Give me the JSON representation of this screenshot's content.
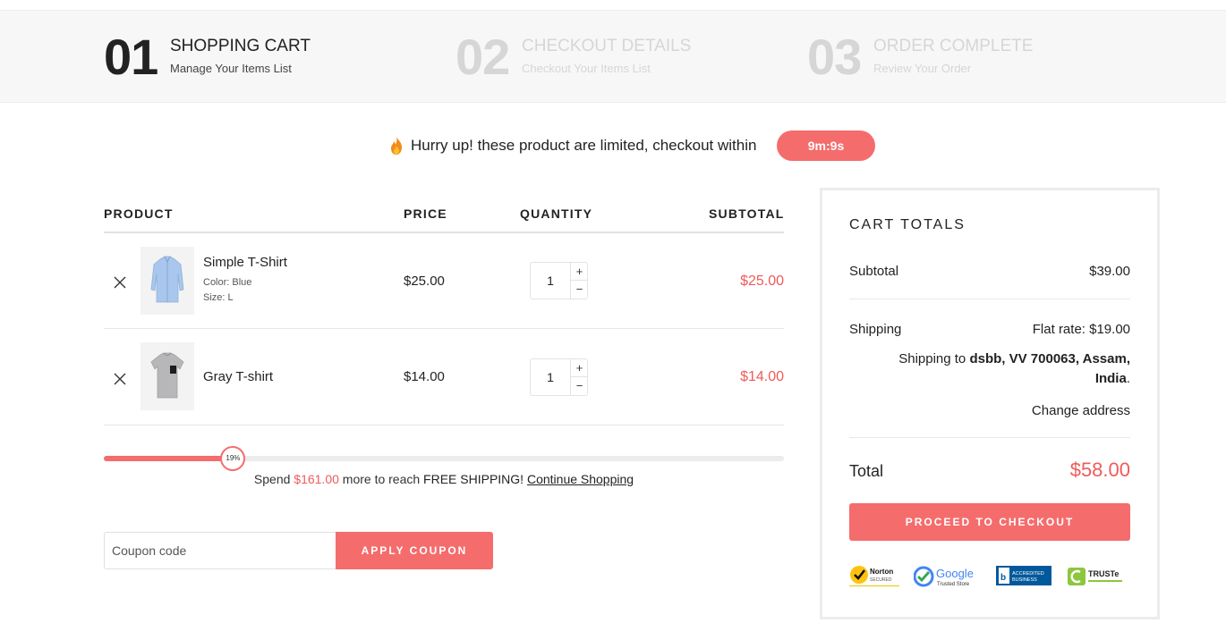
{
  "steps": [
    {
      "num": "01",
      "title": "SHOPPING CART",
      "subtitle": "Manage Your Items List"
    },
    {
      "num": "02",
      "title": "CHECKOUT DETAILS",
      "subtitle": "Checkout Your Items List"
    },
    {
      "num": "03",
      "title": "ORDER COMPLETE",
      "subtitle": "Review Your Order"
    }
  ],
  "hurry": {
    "icon": "fire-icon",
    "message": "Hurry up! these product are limited, checkout within",
    "timer": "9m:9s"
  },
  "cart_table": {
    "headers": {
      "product": "PRODUCT",
      "price": "PRICE",
      "quantity": "QUANTITY",
      "subtotal": "SUBTOTAL"
    },
    "items": [
      {
        "name": "Simple T-Shirt",
        "color": "Color: Blue",
        "size": "Size: L",
        "price": "$25.00",
        "quantity": "1",
        "subtotal": "$25.00",
        "thumb": "blue-shirt-thumbnail"
      },
      {
        "name": "Gray T-shirt",
        "price": "$14.00",
        "quantity": "1",
        "subtotal": "$14.00",
        "thumb": "gray-tshirt-thumbnail"
      }
    ],
    "qty_plus": "+",
    "qty_minus": "−"
  },
  "free_shipping": {
    "progress_percent": 19,
    "progress_label": "19%",
    "text_before": "Spend",
    "amount": "$161.00",
    "text_middle": "more to reach",
    "highlight": "FREE SHIPPING!",
    "link": "Continue Shopping"
  },
  "coupon": {
    "placeholder": "Coupon code",
    "button_label": "APPLY COUPON"
  },
  "cart_totals": {
    "heading": "CART TOTALS",
    "subtotal_label": "Subtotal",
    "subtotal_value": "$39.00",
    "shipping_label": "Shipping",
    "shipping_value": "Flat rate: $19.00",
    "shipping_to_prefix": "Shipping to",
    "shipping_to_address": "dsbb, VV 700063, Assam, India",
    "shipping_to_suffix": ".",
    "change_address": "Change address",
    "total_label": "Total",
    "total_value": "$58.00",
    "checkout_button": "PROCEED TO CHECKOUT",
    "badges": [
      {
        "icon": "norton-secured-badge",
        "text": "Norton",
        "sub": "SECURED"
      },
      {
        "icon": "google-trusted-store-badge",
        "text": "Google",
        "sub": "Trusted Store"
      },
      {
        "icon": "bbb-accredited-badge",
        "text": "ACCREDITED",
        "sub": "BUSINESS"
      },
      {
        "icon": "truste-badge",
        "text": "TRUSTe",
        "sub": ""
      }
    ]
  },
  "colors": {
    "accent": "#f56c6c",
    "accent_text": "#f05a5a",
    "step_inactive": "#d6d6d6",
    "header_bg": "#f7f7f7"
  }
}
